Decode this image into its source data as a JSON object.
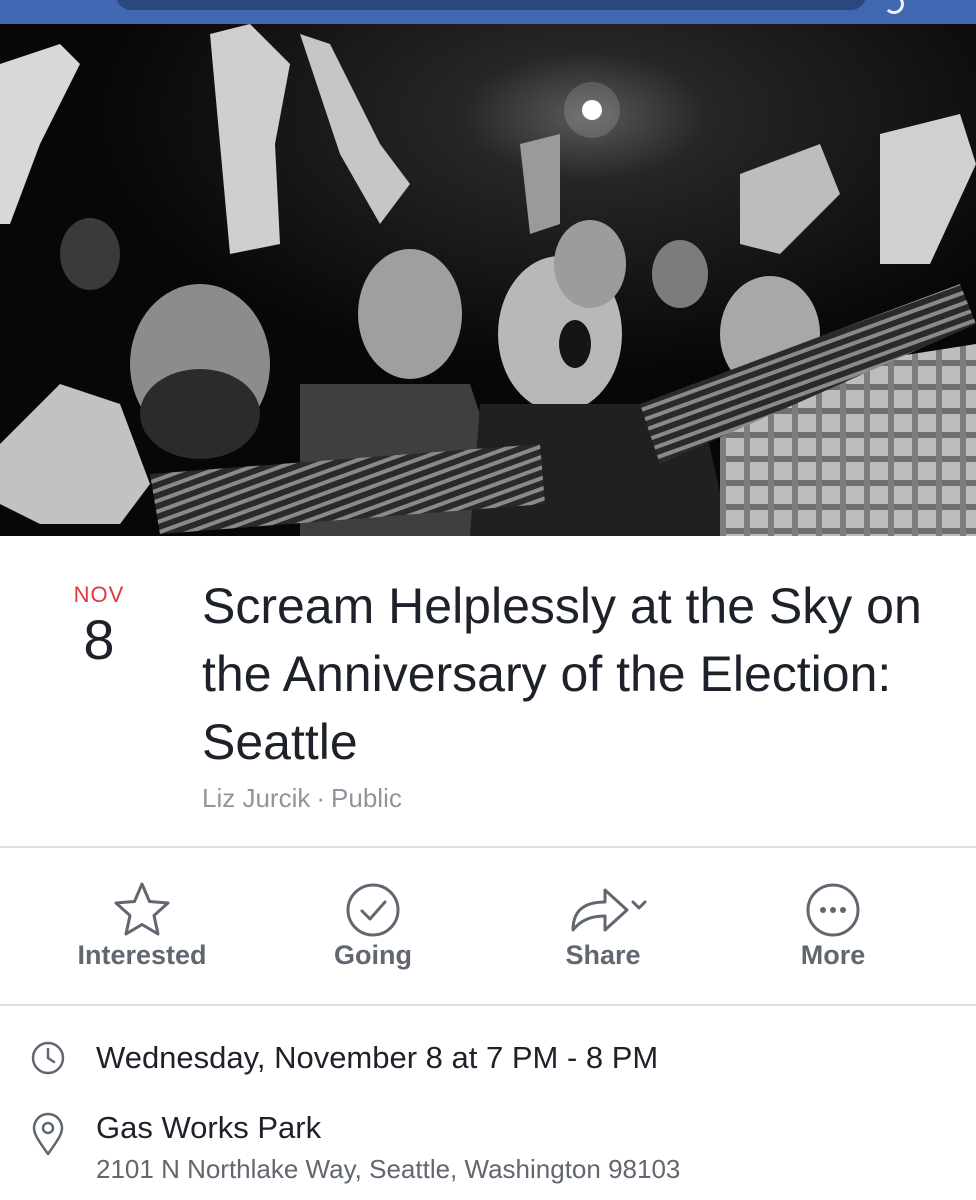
{
  "header": {
    "search_icon": "search-icon",
    "corner_icon": "partial-icon"
  },
  "cover_photo": {
    "description_icon": "cover-photo"
  },
  "event": {
    "month": "NOV",
    "day": "8",
    "title": "Scream Helplessly at the Sky on the Anniversary of the Election: Seattle",
    "host": "Liz Jurcik",
    "separator": "·",
    "privacy": "Public"
  },
  "actions": [
    {
      "label": "Interested",
      "icon": "star-icon"
    },
    {
      "label": "Going",
      "icon": "check-circle-icon"
    },
    {
      "label": "Share",
      "icon": "share-arrow-icon"
    },
    {
      "label": "More",
      "icon": "more-dots-icon"
    }
  ],
  "details": {
    "time": {
      "icon": "clock-icon",
      "text": "Wednesday, November 8 at 7 PM - 8 PM"
    },
    "location": {
      "icon": "location-pin-icon",
      "name": "Gas Works Park",
      "address": "2101 N Northlake Way, Seattle, Washington 98103"
    }
  },
  "colors": {
    "nav_blue": "#4267b2",
    "month_red": "#e0383e",
    "icon_gray": "#606770",
    "divider": "#dddfe2"
  }
}
